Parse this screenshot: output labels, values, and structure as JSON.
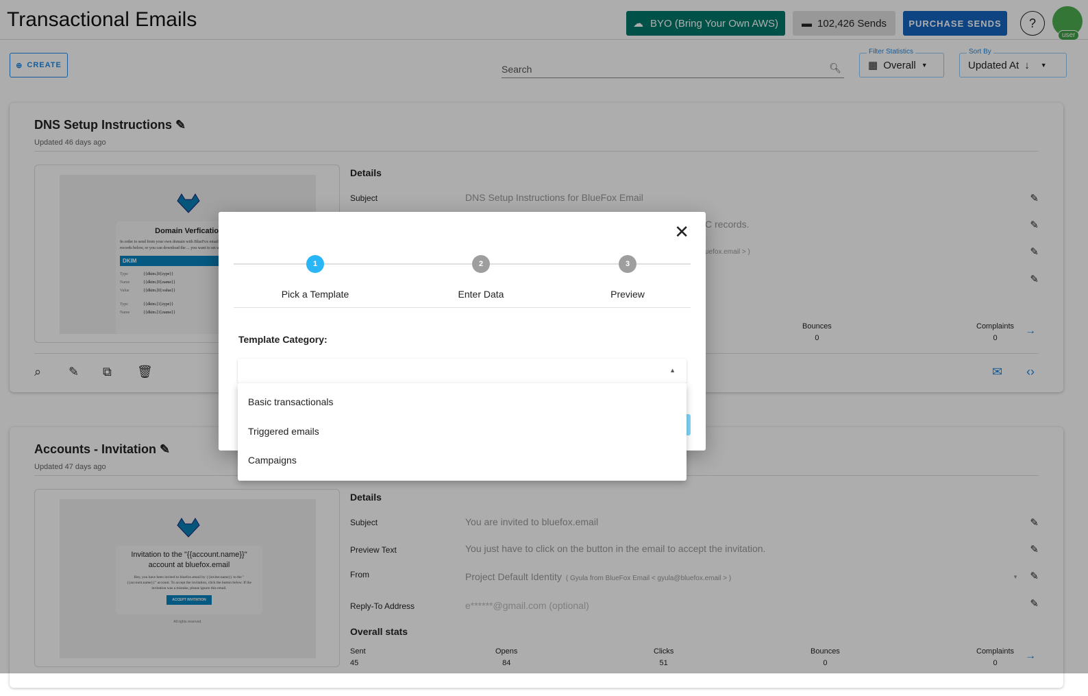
{
  "header": {
    "title": "Transactional Emails",
    "byo_label": "BYO (Bring Your Own AWS)",
    "sends_label": "102,426 Sends",
    "purchase_label": "PURCHASE SENDS",
    "help_label": "?",
    "avatar_label": "user"
  },
  "toolbar": {
    "create_label": "CREATE",
    "search_placeholder": "Search",
    "filter_label": "Filter Statistics",
    "filter_value": "Overall",
    "sort_label": "Sort By",
    "sort_value": "Updated At"
  },
  "cards": [
    {
      "title": "DNS Setup Instructions",
      "updated": "Updated 46 days ago",
      "preview": {
        "heading": "Domain Verfication",
        "body": "In order to send from your own domain with BlueFox email, set up the DNS records below, or you can download the ... you want to set up the records later.",
        "section": "DKIM",
        "rows": [
          [
            "Type",
            "{{dkim.[0].type}}"
          ],
          [
            "Name",
            "{{dkim.[0].name}}"
          ],
          [
            "Value",
            "{{dkim.[0].value}}"
          ],
          [
            "Type",
            "{{dkim.[1].type}}"
          ],
          [
            "Name",
            "{{dkim.[1].name}}"
          ]
        ]
      },
      "details_heading": "Details",
      "subject_label": "Subject",
      "subject": "DNS Setup Instructions for BlueFox Email",
      "preview_text_fragment": "C records.",
      "from_fragment": "uefox.email > )",
      "stats": [
        {
          "label": "Bounces",
          "value": "0"
        },
        {
          "label": "Complaints",
          "value": "0"
        }
      ]
    },
    {
      "title": "Accounts - Invitation",
      "updated": "Updated 47 days ago",
      "preview": {
        "heading": "Invitation to the \"{{account.name}}\" account at bluefox.email",
        "body": "Hey, you have been invited to bluefox.email by {{inviter.name}} to the \"{{account.name}}\" account. To accept the invitation, click the button below. If the invitation was a mistake, please ignore this email.",
        "button": "ACCEPT INVITATION",
        "footer": "All rights reserved."
      },
      "details_heading": "Details",
      "subject_label": "Subject",
      "subject": "You are invited to bluefox.email",
      "preview_text_label": "Preview Text",
      "preview_text": "You just have to click on the button in the email to accept the invitation.",
      "from_label": "From",
      "from": "Project Default Identity",
      "from_detail": "( Gyula from BlueFox Email < gyula@bluefox.email > )",
      "reply_label": "Reply-To Address",
      "reply": "e******@gmail.com (optional)",
      "stats_heading": "Overall stats",
      "stats": [
        {
          "label": "Sent",
          "value": "45"
        },
        {
          "label": "Opens",
          "value": "84"
        },
        {
          "label": "Clicks",
          "value": "51"
        },
        {
          "label": "Bounces",
          "value": "0"
        },
        {
          "label": "Complaints",
          "value": "0"
        }
      ]
    }
  ],
  "modal": {
    "steps": [
      {
        "num": "1",
        "label": "Pick a Template"
      },
      {
        "num": "2",
        "label": "Enter Data"
      },
      {
        "num": "3",
        "label": "Preview"
      }
    ],
    "category_label": "Template Category:",
    "options": [
      "Basic transactionals",
      "Triggered emails",
      "Campaigns"
    ]
  },
  "colors": {
    "accent": "#29b6f6",
    "byo": "#00796b",
    "purchase": "#1565c0"
  }
}
